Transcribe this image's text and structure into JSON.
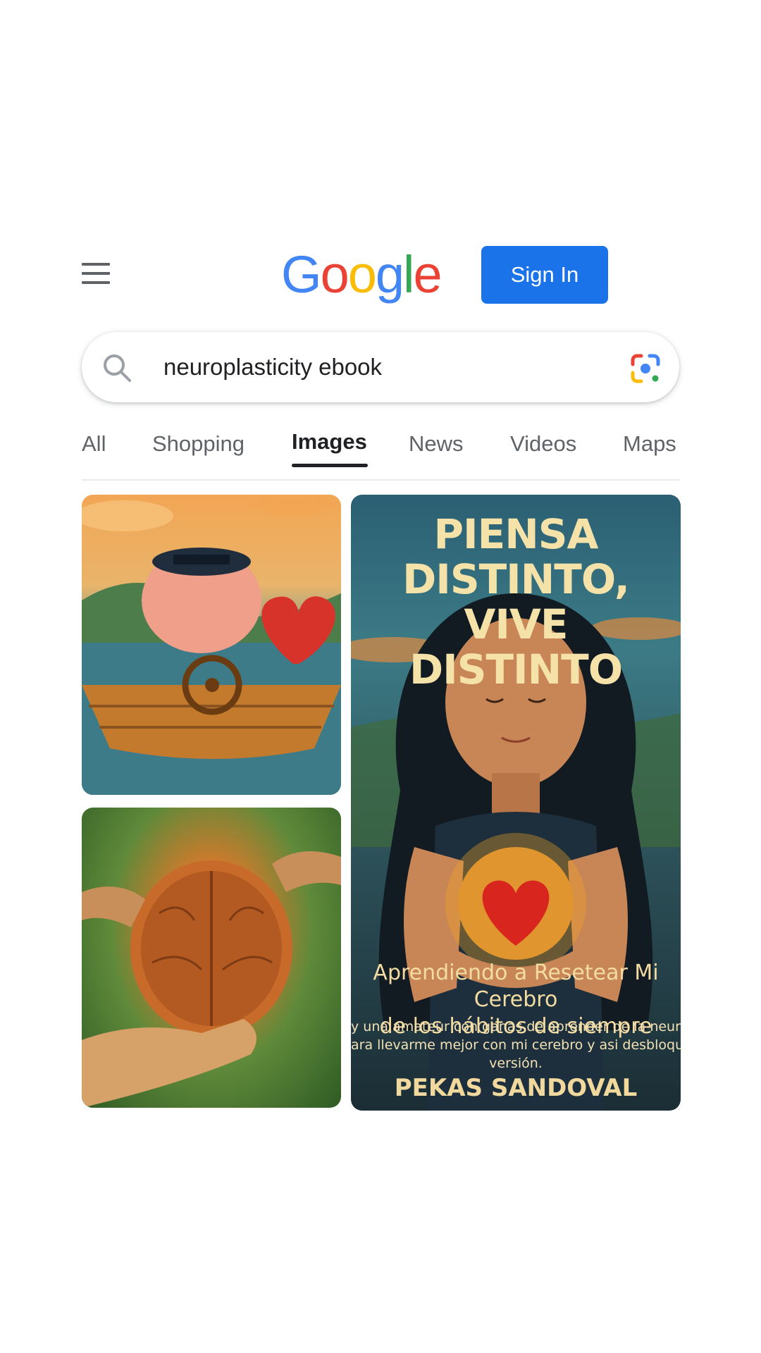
{
  "header": {
    "menu_icon": "hamburger-menu-icon",
    "logo": {
      "letters": [
        "G",
        "o",
        "o",
        "g",
        "l",
        "e"
      ],
      "colors": [
        "#4285F4",
        "#EA4335",
        "#FBBC05",
        "#4285F4",
        "#34A853",
        "#EA4335"
      ]
    },
    "sign_in_label": "Sign In",
    "accent": "#1a73e8"
  },
  "search": {
    "icon": "search-icon",
    "query": "neuroplasticity ebook",
    "lens_icon": "google-lens-icon"
  },
  "tabs": [
    {
      "label": "All",
      "active": false
    },
    {
      "label": "Shopping",
      "active": false
    },
    {
      "label": "Images",
      "active": true
    },
    {
      "label": "News",
      "active": false
    },
    {
      "label": "Videos",
      "active": false
    },
    {
      "label": "Maps",
      "active": false
    }
  ],
  "results": {
    "cover": {
      "title_line1": "PIENSA DISTINTO,",
      "title_line2": "VIVE DISTINTO",
      "subtitle_line1": "Aprendiendo a Resetear Mi Cerebro",
      "subtitle_line2": "de los hábitos de siempre",
      "tagline_line1": "y una amateur con ganas de aprender de la neuroplasti",
      "tagline_line2": "ara llevarme mejor con mi cerebro y asi desbloquear mi",
      "tagline_line3": "versión.",
      "author": "PEKAS SANDOVAL"
    }
  }
}
